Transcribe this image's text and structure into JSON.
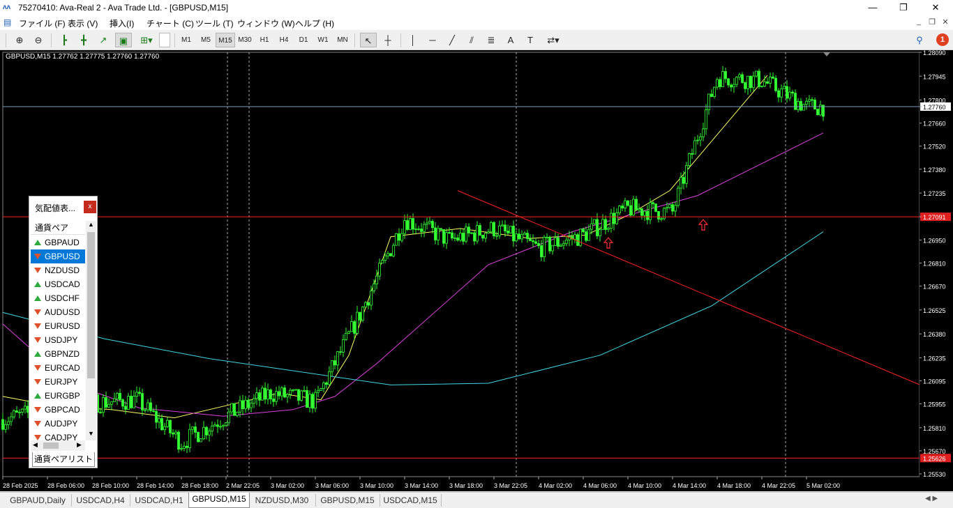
{
  "window": {
    "title": "75270410: Ava-Real 2 - Ava Trade Ltd. - [GBPUSD,M15]",
    "minimize": "—",
    "restore": "❐",
    "close": "✕"
  },
  "menu": [
    "ファイル (F)",
    "表示 (V)",
    "挿入(I)",
    "チャート (C)",
    "ツール (T)",
    "ウィンドウ (W)",
    "ヘルプ (H)"
  ],
  "toolbar": {
    "timeframes": [
      "M1",
      "M5",
      "M15",
      "M30",
      "H1",
      "H4",
      "D1",
      "W1",
      "MN"
    ],
    "active_timeframe": "M15",
    "text_tool": "A",
    "notification_count": "1"
  },
  "chart": {
    "symbol_header": "GBPUSD,M15  1.27762 1.27775 1.27760 1.27760",
    "price_axis": [
      "1.28090",
      "1.27945",
      "1.27800",
      "1.27760",
      "1.27660",
      "1.27520",
      "1.27380",
      "1.27235",
      "1.27091",
      "1.26950",
      "1.26810",
      "1.26670",
      "1.26525",
      "1.26380",
      "1.26235",
      "1.26095",
      "1.25955",
      "1.25810",
      "1.25670",
      "1.25530"
    ],
    "current_price": "1.27760",
    "line_price_upper": "1.27091",
    "line_price_lower": "1.25626",
    "time_axis": [
      "28 Feb 2025",
      "28 Feb 06:00",
      "28 Feb 10:00",
      "28 Feb 14:00",
      "28 Feb 18:00",
      "2 Mar 22:05",
      "3 Mar 02:00",
      "3 Mar 06:00",
      "3 Mar 10:00",
      "3 Mar 14:00",
      "3 Mar 18:00",
      "3 Mar 22:05",
      "4 Mar 02:00",
      "4 Mar 06:00",
      "4 Mar 10:00",
      "4 Mar 14:00",
      "4 Mar 18:00",
      "4 Mar 22:05",
      "5 Mar 02:00"
    ],
    "colors": {
      "background": "#000000",
      "candles": "#32ff32",
      "ma_fast": "#ffff66",
      "ma_mid": "#e040e0",
      "ma_slow": "#40d8e8",
      "horizontal_lines": "#ff2020",
      "trendline": "#ff2020"
    }
  },
  "market_watch": {
    "title": "気配値表...",
    "close": "x",
    "column_header": "通貨ペア",
    "rows": [
      {
        "symbol": "GBPAUD",
        "dir": "up"
      },
      {
        "symbol": "GBPUSD",
        "dir": "down",
        "selected": true
      },
      {
        "symbol": "NZDUSD",
        "dir": "down"
      },
      {
        "symbol": "USDCAD",
        "dir": "up"
      },
      {
        "symbol": "USDCHF",
        "dir": "up"
      },
      {
        "symbol": "AUDUSD",
        "dir": "down"
      },
      {
        "symbol": "EURUSD",
        "dir": "down"
      },
      {
        "symbol": "USDJPY",
        "dir": "down"
      },
      {
        "symbol": "GBPNZD",
        "dir": "up"
      },
      {
        "symbol": "EURCAD",
        "dir": "down"
      },
      {
        "symbol": "EURJPY",
        "dir": "down"
      },
      {
        "symbol": "EURGBP",
        "dir": "up"
      },
      {
        "symbol": "GBPCAD",
        "dir": "down"
      },
      {
        "symbol": "AUDJPY",
        "dir": "down"
      },
      {
        "symbol": "CADJPY",
        "dir": "down"
      }
    ],
    "tab_label": "通貨ペアリスト"
  },
  "chart_tabs": [
    "GBPAUD,Daily",
    "USDCAD,H4",
    "USDCAD,H1",
    "GBPUSD,M15",
    "NZDUSD,M30",
    "GBPUSD,M15",
    "USDCAD,M15"
  ],
  "active_chart_tab": "GBPUSD,M15",
  "chart_data": {
    "type": "candlestick",
    "symbol": "GBPUSD",
    "timeframe": "M15",
    "ylim": [
      1.2553,
      1.2809
    ],
    "x_start": "28 Feb 2025",
    "x_end": "5 Mar 02:00",
    "close_path": [
      [
        "28 Feb 2025",
        1.2586
      ],
      [
        "28 Feb 06:00",
        1.2592
      ],
      [
        "28 Feb 10:00",
        1.2596
      ],
      [
        "28 Feb 14:00",
        1.2598
      ],
      [
        "28 Feb 18:00",
        1.2572
      ],
      [
        "2 Mar 22:05",
        1.2588
      ],
      [
        "3 Mar 02:00",
        1.2602
      ],
      [
        "3 Mar 06:00",
        1.2597
      ],
      [
        "3 Mar 10:00",
        1.265
      ],
      [
        "3 Mar 14:00",
        1.2708
      ],
      [
        "3 Mar 18:00",
        1.2695
      ],
      [
        "3 Mar 22:05",
        1.2702
      ],
      [
        "4 Mar 02:00",
        1.269
      ],
      [
        "4 Mar 06:00",
        1.2698
      ],
      [
        "4 Mar 10:00",
        1.2714
      ],
      [
        "4 Mar 14:00",
        1.2712
      ],
      [
        "4 Mar 18:00",
        1.2794
      ],
      [
        "4 Mar 22:05",
        1.2792
      ],
      [
        "5 Mar 02:00",
        1.2776
      ]
    ],
    "horizontal_lines": [
      1.27091,
      1.25626
    ],
    "trendline": {
      "from": [
        "3 Mar 18:00",
        1.2725
      ],
      "to": [
        "5 Mar 02:00",
        1.2636
      ]
    },
    "moving_averages": [
      {
        "color": "yellow",
        "path": [
          1.26,
          1.2594,
          1.2592,
          1.2587,
          1.2595,
          1.2602,
          1.2598,
          1.2625,
          1.2697,
          1.2702,
          1.2696,
          1.2698,
          1.271,
          1.2725,
          1.2795
        ]
      },
      {
        "color": "magenta",
        "path": [
          1.2644,
          1.2608,
          1.2593,
          1.2588,
          1.2592,
          1.26,
          1.262,
          1.268,
          1.27,
          1.271,
          1.2722,
          1.276
        ]
      },
      {
        "color": "cyan",
        "path": [
          1.2651,
          1.2635,
          1.2623,
          1.2607,
          1.2608,
          1.2625,
          1.2655,
          1.27
        ]
      }
    ],
    "grid": false
  }
}
